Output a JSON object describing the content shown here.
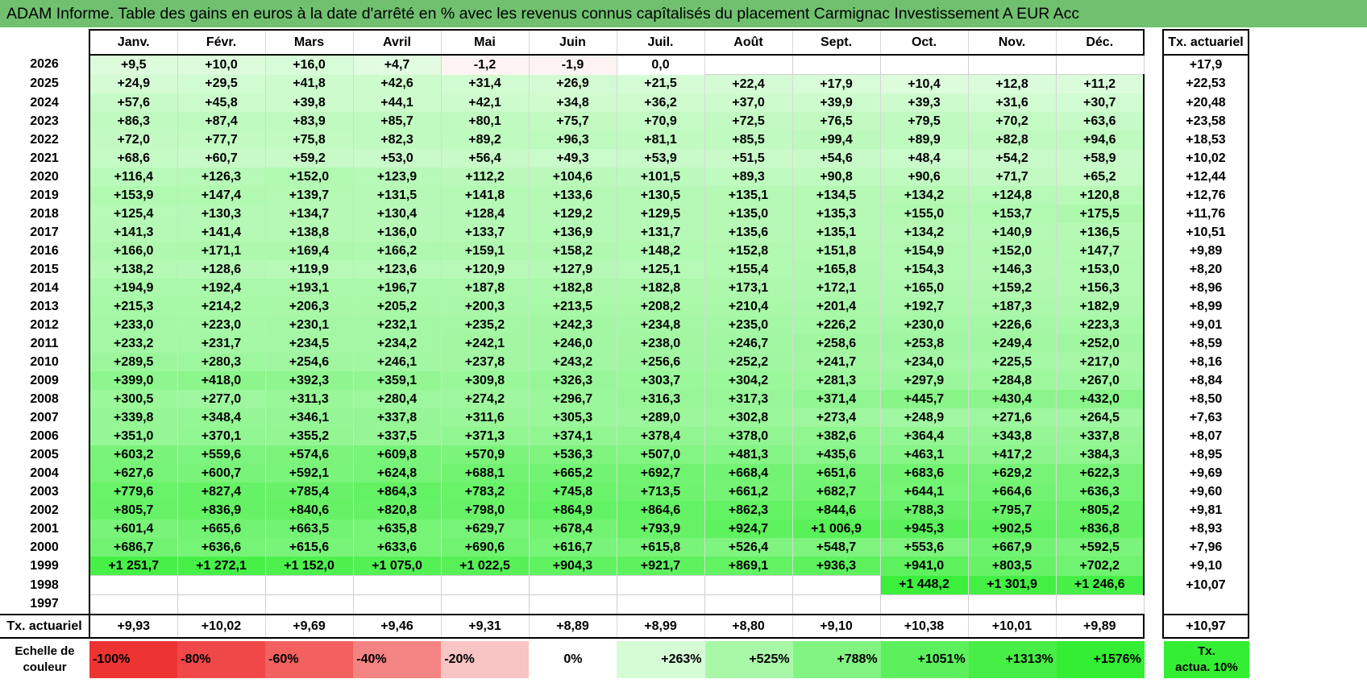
{
  "title": "ADAM Informe. Table des gains en euros à la date d'arrêté en % avec les revenus connus capîtalisés du placement Carmignac Investissement A EUR Acc",
  "chart_data": {
    "type": "table",
    "columns": [
      "Janv.",
      "Févr.",
      "Mars",
      "Avril",
      "Mai",
      "Juin",
      "Juil.",
      "Août",
      "Sept.",
      "Oct.",
      "Nov.",
      "Déc."
    ],
    "rate_header": "Tx. actuariel",
    "rows": [
      {
        "year": "2026",
        "values": [
          "+9,5",
          "+10,0",
          "+16,0",
          "+4,7",
          "-1,2",
          "-1,9",
          "0,0",
          "",
          "",
          "",
          "",
          ""
        ],
        "nums": [
          9.5,
          10.0,
          16.0,
          4.7,
          -1.2,
          -1.9,
          0.0,
          null,
          null,
          null,
          null,
          null
        ],
        "rate": "+17,9"
      },
      {
        "year": "2025",
        "values": [
          "+24,9",
          "+29,5",
          "+41,8",
          "+42,6",
          "+31,4",
          "+26,9",
          "+21,5",
          "+22,4",
          "+17,9",
          "+10,4",
          "+12,8",
          "+11,2"
        ],
        "nums": [
          24.9,
          29.5,
          41.8,
          42.6,
          31.4,
          26.9,
          21.5,
          22.4,
          17.9,
          10.4,
          12.8,
          11.2
        ],
        "rate": "+22,53"
      },
      {
        "year": "2024",
        "values": [
          "+57,6",
          "+45,8",
          "+39,8",
          "+44,1",
          "+42,1",
          "+34,8",
          "+36,2",
          "+37,0",
          "+39,9",
          "+39,3",
          "+31,6",
          "+30,7"
        ],
        "nums": [
          57.6,
          45.8,
          39.8,
          44.1,
          42.1,
          34.8,
          36.2,
          37.0,
          39.9,
          39.3,
          31.6,
          30.7
        ],
        "rate": "+20,48"
      },
      {
        "year": "2023",
        "values": [
          "+86,3",
          "+87,4",
          "+83,9",
          "+85,7",
          "+80,1",
          "+75,7",
          "+70,9",
          "+72,5",
          "+76,5",
          "+79,5",
          "+70,2",
          "+63,6"
        ],
        "nums": [
          86.3,
          87.4,
          83.9,
          85.7,
          80.1,
          75.7,
          70.9,
          72.5,
          76.5,
          79.5,
          70.2,
          63.6
        ],
        "rate": "+23,58"
      },
      {
        "year": "2022",
        "values": [
          "+72,0",
          "+77,7",
          "+75,8",
          "+82,3",
          "+89,2",
          "+96,3",
          "+81,1",
          "+85,5",
          "+99,4",
          "+89,9",
          "+82,8",
          "+94,6"
        ],
        "nums": [
          72.0,
          77.7,
          75.8,
          82.3,
          89.2,
          96.3,
          81.1,
          85.5,
          99.4,
          89.9,
          82.8,
          94.6
        ],
        "rate": "+18,53"
      },
      {
        "year": "2021",
        "values": [
          "+68,6",
          "+60,7",
          "+59,2",
          "+53,0",
          "+56,4",
          "+49,3",
          "+53,9",
          "+51,5",
          "+54,6",
          "+48,4",
          "+54,2",
          "+58,9"
        ],
        "nums": [
          68.6,
          60.7,
          59.2,
          53.0,
          56.4,
          49.3,
          53.9,
          51.5,
          54.6,
          48.4,
          54.2,
          58.9
        ],
        "rate": "+10,02"
      },
      {
        "year": "2020",
        "values": [
          "+116,4",
          "+126,3",
          "+152,0",
          "+123,9",
          "+112,2",
          "+104,6",
          "+101,5",
          "+89,3",
          "+90,8",
          "+90,6",
          "+71,7",
          "+65,2"
        ],
        "nums": [
          116.4,
          126.3,
          152.0,
          123.9,
          112.2,
          104.6,
          101.5,
          89.3,
          90.8,
          90.6,
          71.7,
          65.2
        ],
        "rate": "+12,44"
      },
      {
        "year": "2019",
        "values": [
          "+153,9",
          "+147,4",
          "+139,7",
          "+131,5",
          "+141,8",
          "+133,6",
          "+130,5",
          "+135,1",
          "+134,5",
          "+134,2",
          "+124,8",
          "+120,8"
        ],
        "nums": [
          153.9,
          147.4,
          139.7,
          131.5,
          141.8,
          133.6,
          130.5,
          135.1,
          134.5,
          134.2,
          124.8,
          120.8
        ],
        "rate": "+12,76"
      },
      {
        "year": "2018",
        "values": [
          "+125,4",
          "+130,3",
          "+134,7",
          "+130,4",
          "+128,4",
          "+129,2",
          "+129,5",
          "+135,0",
          "+135,3",
          "+155,0",
          "+153,7",
          "+175,5"
        ],
        "nums": [
          125.4,
          130.3,
          134.7,
          130.4,
          128.4,
          129.2,
          129.5,
          135.0,
          135.3,
          155.0,
          153.7,
          175.5
        ],
        "rate": "+11,76"
      },
      {
        "year": "2017",
        "values": [
          "+141,3",
          "+141,4",
          "+138,8",
          "+136,0",
          "+133,7",
          "+136,9",
          "+131,7",
          "+135,6",
          "+135,1",
          "+134,2",
          "+140,9",
          "+136,5"
        ],
        "nums": [
          141.3,
          141.4,
          138.8,
          136.0,
          133.7,
          136.9,
          131.7,
          135.6,
          135.1,
          134.2,
          140.9,
          136.5
        ],
        "rate": "+10,51"
      },
      {
        "year": "2016",
        "values": [
          "+166,0",
          "+171,1",
          "+169,4",
          "+166,2",
          "+159,1",
          "+158,2",
          "+148,2",
          "+152,8",
          "+151,8",
          "+154,9",
          "+152,0",
          "+147,7"
        ],
        "nums": [
          166.0,
          171.1,
          169.4,
          166.2,
          159.1,
          158.2,
          148.2,
          152.8,
          151.8,
          154.9,
          152.0,
          147.7
        ],
        "rate": "+9,89"
      },
      {
        "year": "2015",
        "values": [
          "+138,2",
          "+128,6",
          "+119,9",
          "+123,6",
          "+120,9",
          "+127,9",
          "+125,1",
          "+155,4",
          "+165,8",
          "+154,3",
          "+146,3",
          "+153,0"
        ],
        "nums": [
          138.2,
          128.6,
          119.9,
          123.6,
          120.9,
          127.9,
          125.1,
          155.4,
          165.8,
          154.3,
          146.3,
          153.0
        ],
        "rate": "+8,20"
      },
      {
        "year": "2014",
        "values": [
          "+194,9",
          "+192,4",
          "+193,1",
          "+196,7",
          "+187,8",
          "+182,8",
          "+182,8",
          "+173,1",
          "+172,1",
          "+165,0",
          "+159,2",
          "+156,3"
        ],
        "nums": [
          194.9,
          192.4,
          193.1,
          196.7,
          187.8,
          182.8,
          182.8,
          173.1,
          172.1,
          165.0,
          159.2,
          156.3
        ],
        "rate": "+8,96"
      },
      {
        "year": "2013",
        "values": [
          "+215,3",
          "+214,2",
          "+206,3",
          "+205,2",
          "+200,3",
          "+213,5",
          "+208,2",
          "+210,4",
          "+201,4",
          "+192,7",
          "+187,3",
          "+182,9"
        ],
        "nums": [
          215.3,
          214.2,
          206.3,
          205.2,
          200.3,
          213.5,
          208.2,
          210.4,
          201.4,
          192.7,
          187.3,
          182.9
        ],
        "rate": "+8,99"
      },
      {
        "year": "2012",
        "values": [
          "+233,0",
          "+223,0",
          "+230,1",
          "+232,1",
          "+235,2",
          "+242,3",
          "+234,8",
          "+235,0",
          "+226,2",
          "+230,0",
          "+226,6",
          "+223,3"
        ],
        "nums": [
          233.0,
          223.0,
          230.1,
          232.1,
          235.2,
          242.3,
          234.8,
          235.0,
          226.2,
          230.0,
          226.6,
          223.3
        ],
        "rate": "+9,01"
      },
      {
        "year": "2011",
        "values": [
          "+233,2",
          "+231,7",
          "+234,5",
          "+234,2",
          "+242,1",
          "+246,0",
          "+238,0",
          "+246,7",
          "+258,6",
          "+253,8",
          "+249,4",
          "+252,0"
        ],
        "nums": [
          233.2,
          231.7,
          234.5,
          234.2,
          242.1,
          246.0,
          238.0,
          246.7,
          258.6,
          253.8,
          249.4,
          252.0
        ],
        "rate": "+8,59"
      },
      {
        "year": "2010",
        "values": [
          "+289,5",
          "+280,3",
          "+254,6",
          "+246,1",
          "+237,8",
          "+243,2",
          "+256,6",
          "+252,2",
          "+241,7",
          "+234,0",
          "+225,5",
          "+217,0"
        ],
        "nums": [
          289.5,
          280.3,
          254.6,
          246.1,
          237.8,
          243.2,
          256.6,
          252.2,
          241.7,
          234.0,
          225.5,
          217.0
        ],
        "rate": "+8,16"
      },
      {
        "year": "2009",
        "values": [
          "+399,0",
          "+418,0",
          "+392,3",
          "+359,1",
          "+309,8",
          "+326,3",
          "+303,7",
          "+304,2",
          "+281,3",
          "+297,9",
          "+284,8",
          "+267,0"
        ],
        "nums": [
          399.0,
          418.0,
          392.3,
          359.1,
          309.8,
          326.3,
          303.7,
          304.2,
          281.3,
          297.9,
          284.8,
          267.0
        ],
        "rate": "+8,84"
      },
      {
        "year": "2008",
        "values": [
          "+300,5",
          "+277,0",
          "+311,3",
          "+280,4",
          "+274,2",
          "+296,7",
          "+316,3",
          "+317,3",
          "+371,4",
          "+445,7",
          "+430,4",
          "+432,0"
        ],
        "nums": [
          300.5,
          277.0,
          311.3,
          280.4,
          274.2,
          296.7,
          316.3,
          317.3,
          371.4,
          445.7,
          430.4,
          432.0
        ],
        "rate": "+8,50"
      },
      {
        "year": "2007",
        "values": [
          "+339,8",
          "+348,4",
          "+346,1",
          "+337,8",
          "+311,6",
          "+305,3",
          "+289,0",
          "+302,8",
          "+273,4",
          "+248,9",
          "+271,6",
          "+264,5"
        ],
        "nums": [
          339.8,
          348.4,
          346.1,
          337.8,
          311.6,
          305.3,
          289.0,
          302.8,
          273.4,
          248.9,
          271.6,
          264.5
        ],
        "rate": "+7,63"
      },
      {
        "year": "2006",
        "values": [
          "+351,0",
          "+370,1",
          "+355,2",
          "+337,5",
          "+371,3",
          "+374,1",
          "+378,4",
          "+378,0",
          "+382,6",
          "+364,4",
          "+343,8",
          "+337,8"
        ],
        "nums": [
          351.0,
          370.1,
          355.2,
          337.5,
          371.3,
          374.1,
          378.4,
          378.0,
          382.6,
          364.4,
          343.8,
          337.8
        ],
        "rate": "+8,07"
      },
      {
        "year": "2005",
        "values": [
          "+603,2",
          "+559,6",
          "+574,6",
          "+609,8",
          "+570,9",
          "+536,3",
          "+507,0",
          "+481,3",
          "+435,6",
          "+463,1",
          "+417,2",
          "+384,3"
        ],
        "nums": [
          603.2,
          559.6,
          574.6,
          609.8,
          570.9,
          536.3,
          507.0,
          481.3,
          435.6,
          463.1,
          417.2,
          384.3
        ],
        "rate": "+8,95"
      },
      {
        "year": "2004",
        "values": [
          "+627,6",
          "+600,7",
          "+592,1",
          "+624,8",
          "+688,1",
          "+665,2",
          "+692,7",
          "+668,4",
          "+651,6",
          "+683,6",
          "+629,2",
          "+622,3"
        ],
        "nums": [
          627.6,
          600.7,
          592.1,
          624.8,
          688.1,
          665.2,
          692.7,
          668.4,
          651.6,
          683.6,
          629.2,
          622.3
        ],
        "rate": "+9,69"
      },
      {
        "year": "2003",
        "values": [
          "+779,6",
          "+827,4",
          "+785,4",
          "+864,3",
          "+783,2",
          "+745,8",
          "+713,5",
          "+661,2",
          "+682,7",
          "+644,1",
          "+664,6",
          "+636,3"
        ],
        "nums": [
          779.6,
          827.4,
          785.4,
          864.3,
          783.2,
          745.8,
          713.5,
          661.2,
          682.7,
          644.1,
          664.6,
          636.3
        ],
        "rate": "+9,60"
      },
      {
        "year": "2002",
        "values": [
          "+805,7",
          "+836,9",
          "+840,6",
          "+820,8",
          "+798,0",
          "+864,9",
          "+864,6",
          "+862,3",
          "+844,6",
          "+788,3",
          "+795,7",
          "+805,2"
        ],
        "nums": [
          805.7,
          836.9,
          840.6,
          820.8,
          798.0,
          864.9,
          864.6,
          862.3,
          844.6,
          788.3,
          795.7,
          805.2
        ],
        "rate": "+9,81"
      },
      {
        "year": "2001",
        "values": [
          "+601,4",
          "+665,6",
          "+663,5",
          "+635,8",
          "+629,7",
          "+678,4",
          "+793,9",
          "+924,7",
          "+1 006,9",
          "+945,3",
          "+902,5",
          "+836,8"
        ],
        "nums": [
          601.4,
          665.6,
          663.5,
          635.8,
          629.7,
          678.4,
          793.9,
          924.7,
          1006.9,
          945.3,
          902.5,
          836.8
        ],
        "rate": "+8,93"
      },
      {
        "year": "2000",
        "values": [
          "+686,7",
          "+636,6",
          "+615,6",
          "+633,6",
          "+690,6",
          "+616,7",
          "+615,8",
          "+526,4",
          "+548,7",
          "+553,6",
          "+667,9",
          "+592,5"
        ],
        "nums": [
          686.7,
          636.6,
          615.6,
          633.6,
          690.6,
          616.7,
          615.8,
          526.4,
          548.7,
          553.6,
          667.9,
          592.5
        ],
        "rate": "+7,96"
      },
      {
        "year": "1999",
        "values": [
          "+1 251,7",
          "+1 272,1",
          "+1 152,0",
          "+1 075,0",
          "+1 022,5",
          "+904,3",
          "+921,7",
          "+869,1",
          "+936,3",
          "+941,0",
          "+803,5",
          "+702,2"
        ],
        "nums": [
          1251.7,
          1272.1,
          1152.0,
          1075.0,
          1022.5,
          904.3,
          921.7,
          869.1,
          936.3,
          941.0,
          803.5,
          702.2
        ],
        "rate": "+9,10"
      },
      {
        "year": "1998",
        "values": [
          "",
          "",
          "",
          "",
          "",
          "",
          "",
          "",
          "",
          "+1 448,2",
          "+1 301,9",
          "+1 246,6"
        ],
        "nums": [
          null,
          null,
          null,
          null,
          null,
          null,
          null,
          null,
          null,
          1448.2,
          1301.9,
          1246.6
        ],
        "rate": "+10,07"
      },
      {
        "year": "1997",
        "values": [
          "",
          "",
          "",
          "",
          "",
          "",
          "",
          "",
          "",
          "",
          "",
          ""
        ],
        "nums": [
          null,
          null,
          null,
          null,
          null,
          null,
          null,
          null,
          null,
          null,
          null,
          null
        ],
        "rate": ""
      }
    ],
    "footer": {
      "label": "Tx. actuariel",
      "values": [
        "+9,93",
        "+10,02",
        "+9,69",
        "+9,46",
        "+9,31",
        "+8,89",
        "+8,99",
        "+8,80",
        "+9,10",
        "+10,38",
        "+10,01",
        "+9,89"
      ],
      "rate": "+10,97"
    },
    "color_scale": {
      "label_line1": "Echelle de",
      "label_line2": "couleur",
      "steps": [
        {
          "label": "-100%",
          "color": "#ee3333",
          "kind": "neg"
        },
        {
          "label": "-80%",
          "color": "#f04848",
          "kind": "neg"
        },
        {
          "label": "-60%",
          "color": "#f26060",
          "kind": "neg"
        },
        {
          "label": "-40%",
          "color": "#f48484",
          "kind": "neg"
        },
        {
          "label": "-20%",
          "color": "#f9c4c4",
          "kind": "neg"
        },
        {
          "label": "0%",
          "color": "#ffffff",
          "kind": "zero"
        },
        {
          "label": "+263%",
          "color": "#d6fcd6",
          "kind": "pos"
        },
        {
          "label": "+525%",
          "color": "#a8f8a8",
          "kind": "pos"
        },
        {
          "label": "+788%",
          "color": "#82f482",
          "kind": "pos"
        },
        {
          "label": "+1051%",
          "color": "#5cf05c",
          "kind": "pos"
        },
        {
          "label": "+1313%",
          "color": "#46ee46",
          "kind": "pos"
        },
        {
          "label": "+1576%",
          "color": "#33ee33",
          "kind": "pos"
        }
      ],
      "rate_label_line1": "Tx.",
      "rate_label_line2": "actua. 10%"
    }
  }
}
